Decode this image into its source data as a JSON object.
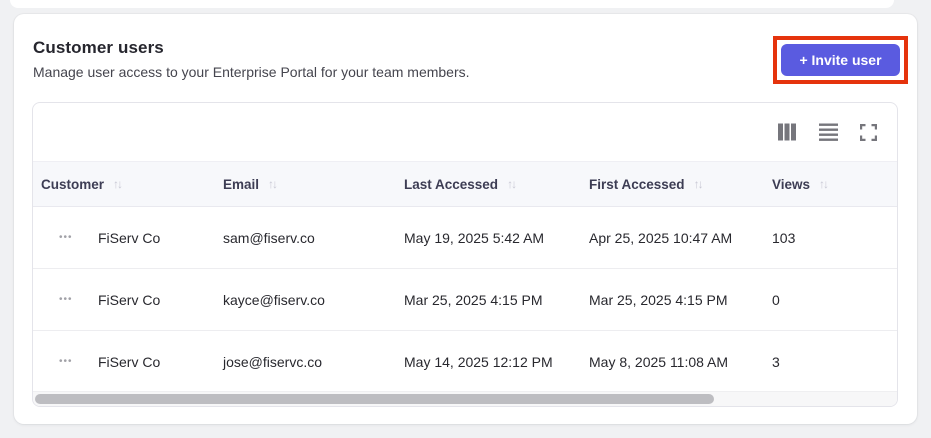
{
  "colors": {
    "accent": "#5a5be0",
    "annotation_highlight": "#e5330d",
    "header_bg": "#f7f8fb",
    "page_bg": "#f0f1f3"
  },
  "panel": {
    "title": "Customer users",
    "subtitle": "Manage user access to your Enterprise Portal for your team members.",
    "invite_button": {
      "label": "+ Invite user"
    }
  },
  "toolbar": {
    "icons": [
      {
        "name": "column-view-icon"
      },
      {
        "name": "row-density-icon"
      },
      {
        "name": "fullscreen-icon"
      }
    ]
  },
  "table": {
    "sort_glyph": "↑↓",
    "row_menu_glyph": "•••",
    "columns": [
      {
        "label": "Customer"
      },
      {
        "label": "Email"
      },
      {
        "label": "Last Accessed"
      },
      {
        "label": "First Accessed"
      },
      {
        "label": "Views"
      }
    ],
    "rows": [
      {
        "customer": "FiServ Co",
        "email": "sam@fiserv.co",
        "last_accessed": "May 19, 2025 5:42 AM",
        "first_accessed": "Apr 25, 2025 10:47 AM",
        "views": "103"
      },
      {
        "customer": "FiServ Co",
        "email": "kayce@fiserv.co",
        "last_accessed": "Mar 25, 2025 4:15 PM",
        "first_accessed": "Mar 25, 2025 4:15 PM",
        "views": "0"
      },
      {
        "customer": "FiServ Co",
        "email": "jose@fiservc.co",
        "last_accessed": "May 14, 2025 12:12 PM",
        "first_accessed": "May 8, 2025 11:08 AM",
        "views": "3"
      }
    ]
  }
}
